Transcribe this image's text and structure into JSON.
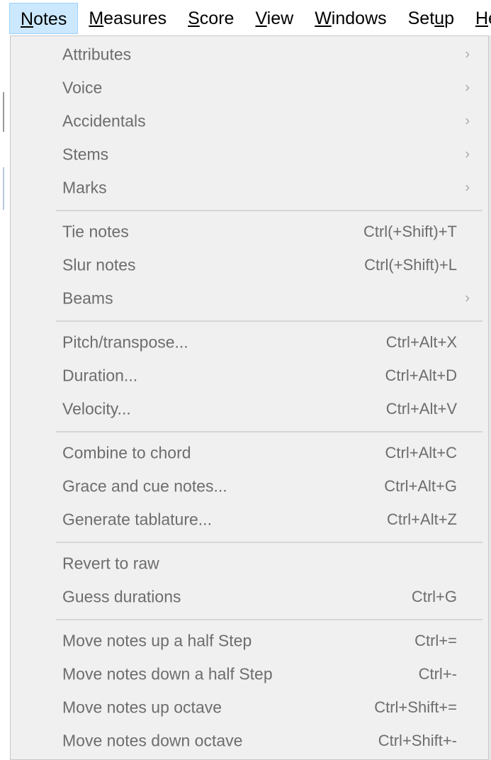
{
  "menubar": {
    "items": [
      {
        "pre": "",
        "mn": "N",
        "post": "otes"
      },
      {
        "pre": "",
        "mn": "M",
        "post": "easures"
      },
      {
        "pre": "",
        "mn": "S",
        "post": "core"
      },
      {
        "pre": "",
        "mn": "V",
        "post": "iew"
      },
      {
        "pre": "",
        "mn": "W",
        "post": "indows"
      },
      {
        "pre": "Set",
        "mn": "u",
        "post": "p"
      },
      {
        "pre": "",
        "mn": "H",
        "post": "e"
      }
    ]
  },
  "menu": {
    "items": [
      {
        "label": "Attributes",
        "shortcut": "",
        "arrow": "›"
      },
      {
        "label": "Voice",
        "shortcut": "",
        "arrow": "›"
      },
      {
        "label": "Accidentals",
        "shortcut": "",
        "arrow": "›"
      },
      {
        "label": "Stems",
        "shortcut": "",
        "arrow": "›"
      },
      {
        "label": "Marks",
        "shortcut": "",
        "arrow": "›"
      },
      {
        "label": "Tie notes",
        "shortcut": "Ctrl(+Shift)+T",
        "arrow": ""
      },
      {
        "label": "Slur notes",
        "shortcut": "Ctrl(+Shift)+L",
        "arrow": ""
      },
      {
        "label": "Beams",
        "shortcut": "",
        "arrow": "›"
      },
      {
        "label": "Pitch/transpose...",
        "shortcut": "Ctrl+Alt+X",
        "arrow": ""
      },
      {
        "label": "Duration...",
        "shortcut": "Ctrl+Alt+D",
        "arrow": ""
      },
      {
        "label": "Velocity...",
        "shortcut": "Ctrl+Alt+V",
        "arrow": ""
      },
      {
        "label": "Combine to chord",
        "shortcut": "Ctrl+Alt+C",
        "arrow": ""
      },
      {
        "label": "Grace and cue notes...",
        "shortcut": "Ctrl+Alt+G",
        "arrow": ""
      },
      {
        "label": "Generate tablature...",
        "shortcut": "Ctrl+Alt+Z",
        "arrow": ""
      },
      {
        "label": "Revert to raw",
        "shortcut": "",
        "arrow": ""
      },
      {
        "label": "Guess durations",
        "shortcut": "Ctrl+G",
        "arrow": ""
      },
      {
        "label": "Move notes up a half Step",
        "shortcut": "Ctrl+=",
        "arrow": ""
      },
      {
        "label": "Move notes down a half Step",
        "shortcut": "Ctrl+-",
        "arrow": ""
      },
      {
        "label": "Move notes up octave",
        "shortcut": "Ctrl+Shift+=",
        "arrow": ""
      },
      {
        "label": "Move notes down octave",
        "shortcut": "Ctrl+Shift+-",
        "arrow": ""
      }
    ]
  }
}
